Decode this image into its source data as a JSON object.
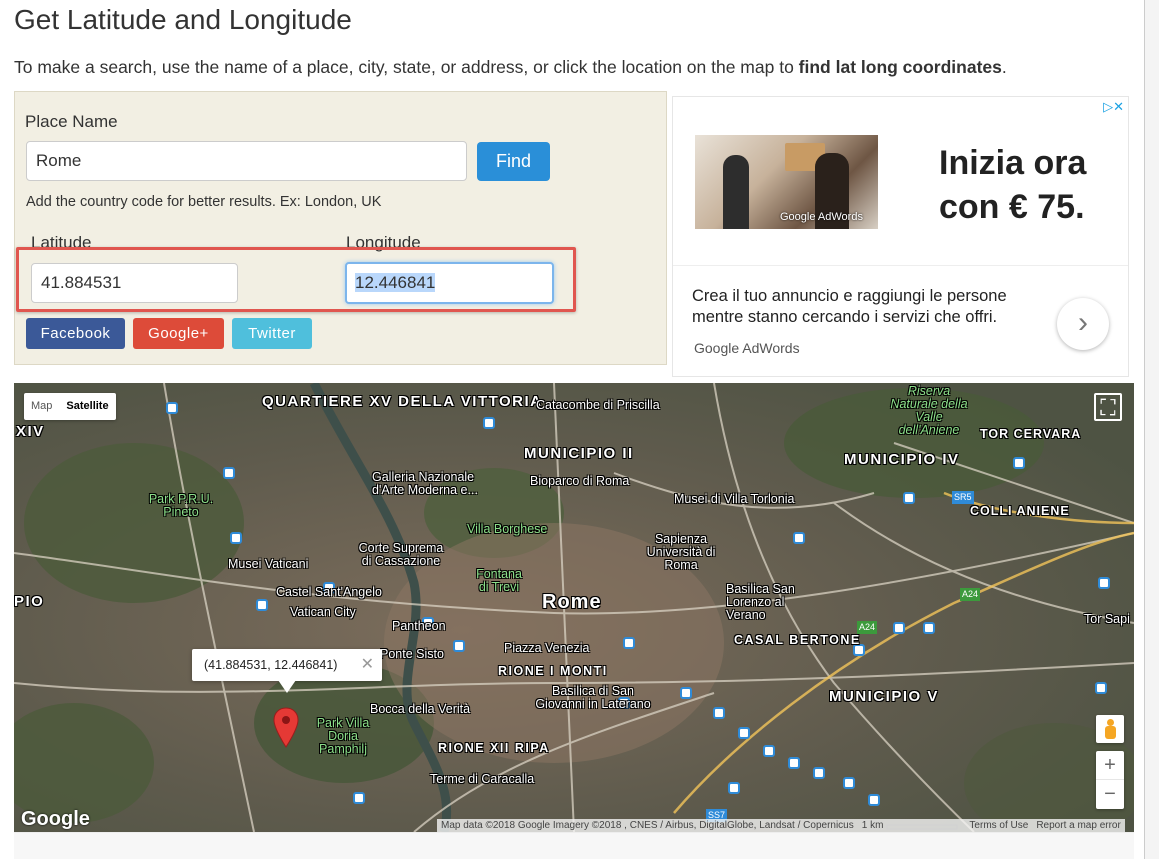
{
  "page": {
    "title": "Get Latitude and Longitude",
    "intro_prefix": "To make a search, use the name of a place, city, state, or address, or click the location on the map to ",
    "intro_bold": "find lat long coordinates",
    "intro_suffix": "."
  },
  "form": {
    "place_label": "Place Name",
    "place_value": "Rome",
    "find_label": "Find",
    "hint": "Add the country code for better results. Ex: London, UK",
    "latitude_label": "Latitude",
    "longitude_label": "Longitude",
    "latitude_value": "41.884531",
    "longitude_value": "12.446841",
    "share": {
      "facebook": "Facebook",
      "google_plus": "Google+",
      "twitter": "Twitter"
    },
    "highlight_color": "#e0564f"
  },
  "ad": {
    "headline_line1": "Inizia ora",
    "headline_line2": "con € 75.",
    "image_watermark": "Google AdWords",
    "body": "Crea il tuo annuncio e raggiungi le persone mentre stanno cercando i servizi che offri.",
    "brand": "Google AdWords",
    "arrow": "›",
    "choice_icon": "adchoices-icon"
  },
  "map": {
    "type_buttons": [
      "Map",
      "Satellite"
    ],
    "selected_type": "Satellite",
    "infowindow_text": "(41.884531, 12.446841)",
    "infowindow_close": "✕",
    "zoom_in": "+",
    "zoom_out": "−",
    "fullscreen_icon": "⛶",
    "logo": "Google",
    "attribution": {
      "data": "Map data ©2018 Google Imagery ©2018 , CNES / Airbus, DigitalGlobe, Landsat / Copernicus",
      "scale": "1 km",
      "terms": "Terms of Use",
      "report": "Report a map error"
    },
    "labels": {
      "quartiere": "QUARTIERE XV DELLA VITTORIA",
      "catacombe": "Catacombe di Priscilla",
      "riserva": "Riserva Naturale della Valle dell'Aniene",
      "tor_cervara": "TOR CERVARA",
      "xiv": "XIV",
      "municipio_ii": "MUNICIPIO II",
      "galleria": "Galleria Nazionale d'Arte Moderna e...",
      "bioparco": "Bioparco di Roma",
      "musei_torlonia": "Musei di Villa Torlonia",
      "municipio_iv": "MUNICIPIO IV",
      "park_pineto": "Park P.R.U. Pineto",
      "villa_borghese": "Villa Borghese",
      "colli_aniene": "COLLI ANIENE",
      "sapienza": "Sapienza Università di Roma",
      "corte": "Corte Suprema di Cassazione",
      "musei_vaticani": "Musei Vaticani",
      "fontana": "Fontana di Trevi",
      "castel": "Castel Sant'Angelo",
      "basilica_lorenzo": "Basilica San Lorenzo al Verano",
      "pio": "PIO",
      "vatican": "Vatican City",
      "rome": "Rome",
      "pantheon": "Pantheon",
      "piazza_venezia": "Piazza Venezia",
      "ponte_sisto": "Ponte Sisto",
      "casal_bertone": "CASAL BERTONE",
      "rione_monti": "RIONE I MONTI",
      "basilica_giovanni": "Basilica di San Giovanni in Laterano",
      "municipio_v": "MUNICIPIO V",
      "bocca": "Bocca della Verità",
      "park_doria": "Park Villa Doria Pamphilj",
      "rione_ripa": "RIONE XII RIPA",
      "terme": "Terme di Caracalla",
      "tor_sapienza": "Tor Sapi",
      "sr5": "SR5",
      "a24": "A24",
      "ss7": "SS7"
    }
  }
}
